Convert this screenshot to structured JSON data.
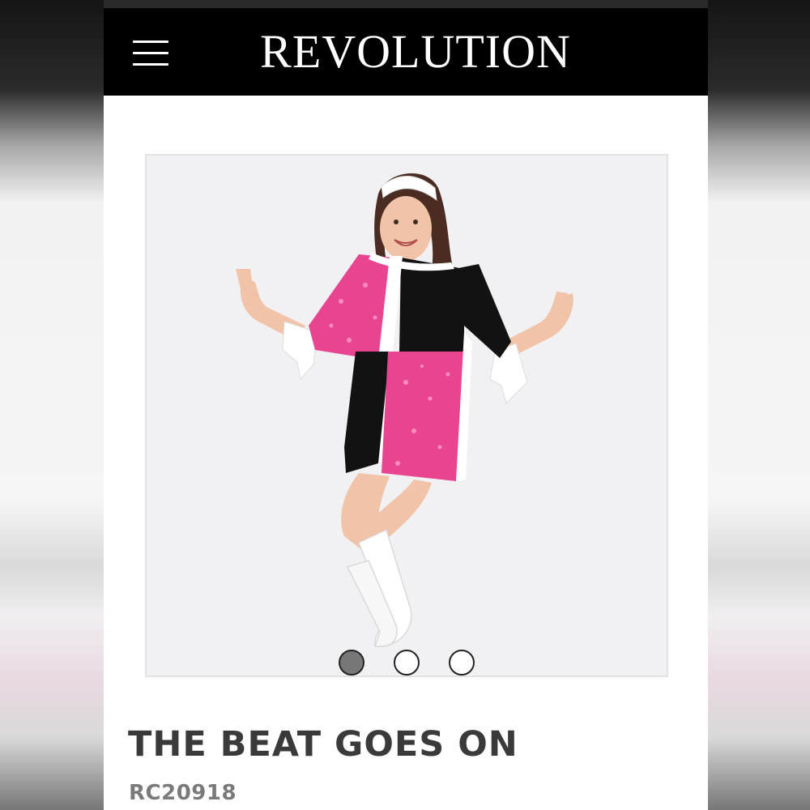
{
  "header": {
    "brand": "REVOLUTION",
    "menu_icon": "hamburger-menu-icon"
  },
  "product": {
    "title": "THE BEAT GOES ON",
    "sku": "RC20918",
    "image_alt_subject": "dancer in pink sequin and black color-block mod dress with white headband and white go-go boots",
    "gallery": {
      "total_images": 3,
      "active_index": 0
    }
  },
  "colors": {
    "header_bg": "#000000",
    "accent_pink": "#e8448f",
    "dress_black": "#121212",
    "text_title": "#3a3a3a",
    "text_sku": "#7a7a7a"
  }
}
